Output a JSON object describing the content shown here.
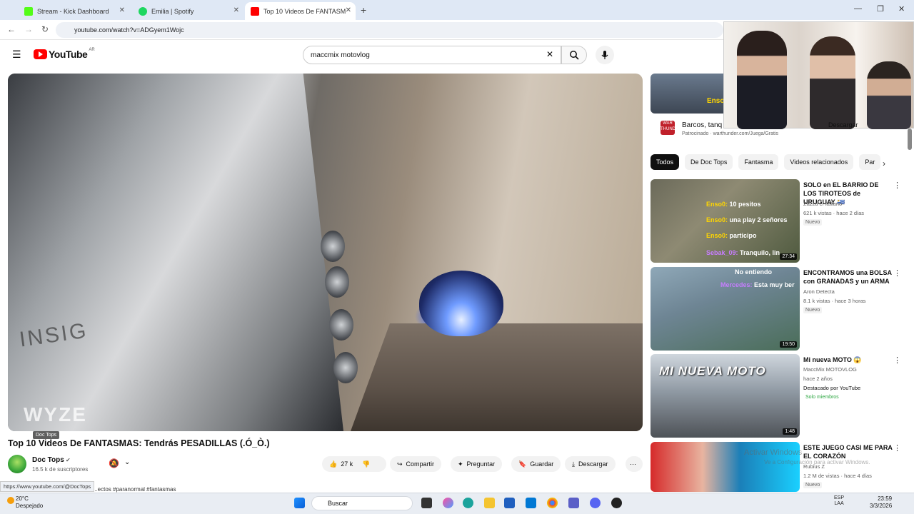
{
  "browser": {
    "tabs": [
      {
        "title": "Stream - Kick Dashboard",
        "color": "#53fc18"
      },
      {
        "title": "Emilia | Spotify",
        "color": "#1ed760"
      },
      {
        "title": "Top 10 Videos De FANTASM",
        "color": "#ff0000",
        "active": true
      }
    ],
    "url": "youtube.com/watch?v=ADGyem1Wojc"
  },
  "youtube": {
    "logo_text": "YouTube",
    "country": "AR",
    "search_value": "maccmix motovlog"
  },
  "video": {
    "watermark": "WYZE",
    "oven_text": "INSIG",
    "tooltip": "Doc Tops",
    "title": "Top 10 Videos De FANTASMAS: Tendrás PESADILLAS (.Ó_Ò.)",
    "channel": "Doc Tops",
    "subs": "16.5 k de suscriptores",
    "likes": "27 k",
    "actions": {
      "share": "Compartir",
      "ask": "Preguntar",
      "save": "Guardar",
      "download": "Descargar"
    },
    "hover_url": "https://www.youtube.com/@DocTops",
    "desc_snippet": "...ectos #paranormal #fantasmas"
  },
  "ad": {
    "logo": "WAR THUNDER",
    "title": "Barcos, tanq",
    "sponsor": "Patrocinado · warthunder.com/Juega/Gratis",
    "button": "Descargar",
    "overlay_name": "Enso"
  },
  "chips": [
    "Todos",
    "De Doc Tops",
    "Fantasma",
    "Videos relacionados",
    "Par"
  ],
  "recommendations": [
    {
      "title": "SOLO en EL BARRIO DE LOS TIROTEOS de URUGUAY 🇺🇾",
      "channel": "Zazza el italiano",
      "views": "621 k vistas · hace 2 días",
      "badge": "Nuevo",
      "duration": "27:34",
      "chat": [
        {
          "name": "Enso0:",
          "text": "10 pesitos"
        },
        {
          "name": "Enso0:",
          "text": "una play 2 señores"
        },
        {
          "name": "Enso0:",
          "text": "participo"
        },
        {
          "name": "Sebak_09:",
          "text": "Tranquilo, lin"
        }
      ]
    },
    {
      "title": "ENCONTRAMOS una BOLSA con GRANADAS y un ARMA",
      "channel": "Aron Detecta",
      "views": "8.1 k vistas · hace 3 horas",
      "badge": "Nuevo",
      "duration": "19:50",
      "chat": [
        {
          "name": "",
          "text": "No entiendo"
        },
        {
          "name": "Mercedes:",
          "text": "Esta muy ber"
        }
      ]
    },
    {
      "title": "Mi nueva MOTO 😱",
      "channel": "MaccMix MOTOVLOG",
      "views": "hace 2 años",
      "extra": "Destacado por YouTube",
      "badge": "Solo miembros",
      "duration": "1:48",
      "thumb_text": "MI NUEVA MOTO"
    },
    {
      "title": "ESTE JUEGO CASI ME PARA EL CORAZÓN",
      "channel": "Rubius Z",
      "views": "1.2 M de vistas · hace 4 días",
      "badge": "Nuevo"
    }
  ],
  "windows_watermark": {
    "line1": "Activar Windows",
    "line2": "Ve a Configuración para activar Windows."
  },
  "taskbar": {
    "temp": "20°C",
    "weather": "Despejado",
    "search": "Buscar",
    "lang1": "ESP",
    "lang2": "LAA",
    "time": "23:59",
    "date": "3/3/2026"
  }
}
